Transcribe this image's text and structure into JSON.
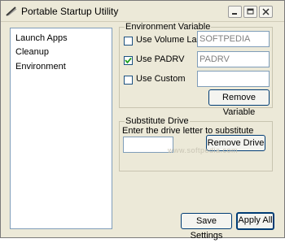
{
  "window": {
    "title": "Portable Startup Utility",
    "controls": {
      "minimize": "minimize-icon",
      "maximize": "maximize-icon",
      "close": "close-icon"
    }
  },
  "sidebar": {
    "items": [
      {
        "label": "Launch Apps"
      },
      {
        "label": "Cleanup"
      },
      {
        "label": "Environment"
      }
    ]
  },
  "env_group": {
    "title": "Environment Variable",
    "volume_label": {
      "label": "Use Volume Label",
      "checked": false,
      "value": "SOFTPEDIA"
    },
    "padrv": {
      "label": "Use PADRV",
      "checked": true,
      "value": "PADRV"
    },
    "custom": {
      "label": "Use Custom",
      "checked": false,
      "value": ""
    },
    "remove_button": "Remove Variable"
  },
  "subst_group": {
    "title": "Substitute Drive",
    "prompt": "Enter the drive letter to substitute",
    "drive_value": "",
    "remove_button": "Remove Drive"
  },
  "footer": {
    "save_label": "Save Settings",
    "apply_label": "Apply All"
  },
  "watermark": "www.softpedia.com",
  "colors": {
    "face": "#ece9d8",
    "border_accent": "#003c74",
    "check": "#21a121"
  }
}
